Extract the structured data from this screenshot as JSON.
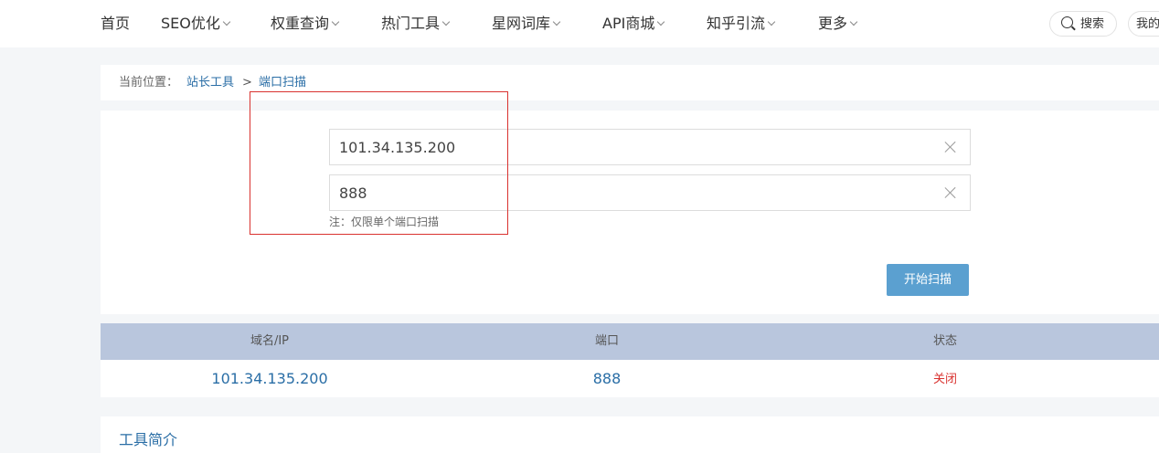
{
  "nav": {
    "items": [
      {
        "label": "首页",
        "dropdown": false
      },
      {
        "label": "SEO优化",
        "dropdown": true
      },
      {
        "label": "权重查询",
        "dropdown": true
      },
      {
        "label": "热门工具",
        "dropdown": true
      },
      {
        "label": "星网词库",
        "dropdown": true
      },
      {
        "label": "API商城",
        "dropdown": true
      },
      {
        "label": "知乎引流",
        "dropdown": true
      },
      {
        "label": "更多",
        "dropdown": true
      }
    ],
    "search_label": "搜索",
    "my_label": "我的"
  },
  "breadcrumb": {
    "prefix": "当前位置：",
    "parent": "站长工具",
    "separator": ">",
    "current": "端口扫描"
  },
  "form": {
    "host_value": "101.34.135.200",
    "port_value": "888",
    "note": "注：仅限单个端口扫描",
    "scan_button": "开始扫描"
  },
  "table": {
    "headers": [
      "域名/IP",
      "端口",
      "状态"
    ],
    "rows": [
      {
        "host": "101.34.135.200",
        "port": "888",
        "status": "关闭"
      }
    ]
  },
  "intro": {
    "title": "工具简介"
  },
  "colors": {
    "accent": "#2a6ea6",
    "button": "#5ba0d0",
    "table_header": "#b9c6dd",
    "status_closed": "#d9322f",
    "highlight_box": "#d9322f"
  }
}
